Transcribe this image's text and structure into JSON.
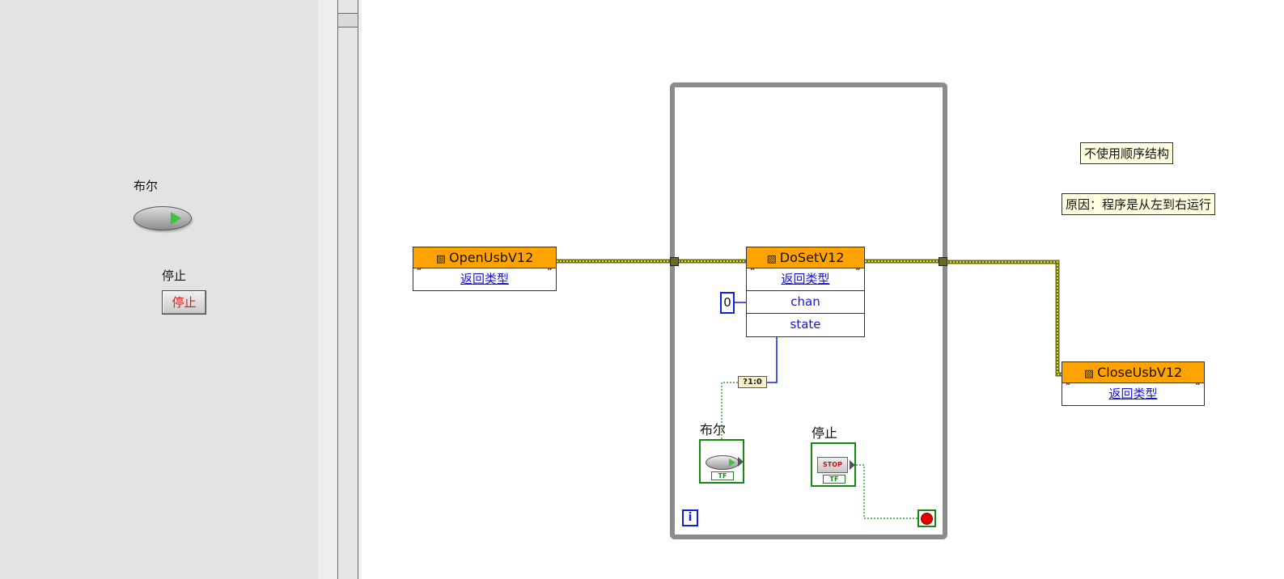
{
  "front_panel": {
    "boolean_label": "布尔",
    "stop_label": "停止",
    "stop_button_text": "停止"
  },
  "block_diagram": {
    "open_node": {
      "title": "OpenUsbV12",
      "output": "返回类型"
    },
    "doset_node": {
      "title": "DoSetV12",
      "rows": [
        "返回类型",
        "chan",
        "state"
      ]
    },
    "close_node": {
      "title": "CloseUsbV12",
      "output": "返回类型"
    },
    "constant_value": "0",
    "bool_to_num_text": "?1:0",
    "boolean_terminal_label": "布尔",
    "stop_terminal_label": "停止",
    "stop_terminal_text": "STOP",
    "terminal_type": "TF",
    "loop_index_text": "i",
    "comments": [
      "不使用顺序结构",
      "原因：程序是从左到右运行"
    ]
  },
  "colors": {
    "node_header": "#ffa300",
    "wire_error": "#8c8c1a",
    "wire_bool": "#148a14",
    "wire_numeric": "#1020e0",
    "loop_border": "#8c8c8c",
    "front_panel_bg": "#e3e3e3"
  }
}
